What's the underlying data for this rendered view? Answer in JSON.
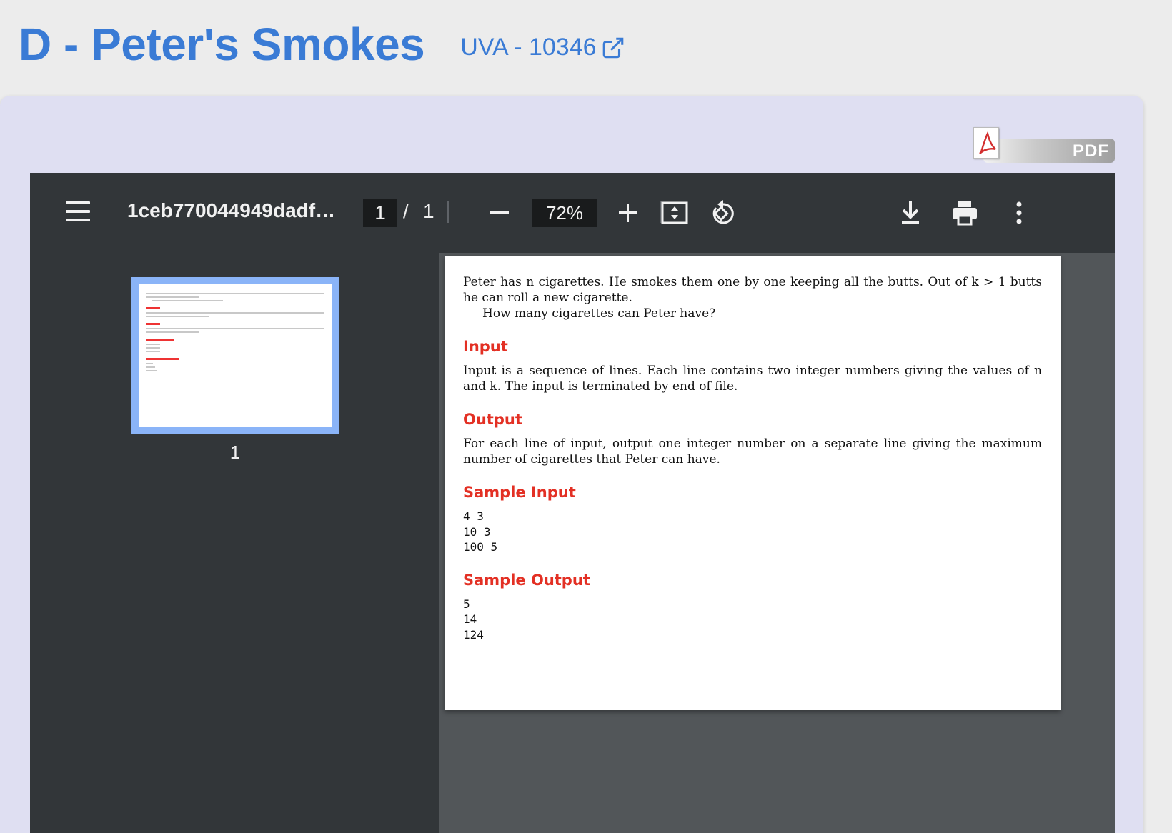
{
  "header": {
    "title": "D - Peter's Smokes",
    "origin_link": "UVA - 10346"
  },
  "pdf_badge": {
    "label": "PDF"
  },
  "toolbar": {
    "file_name": "1ceb770044949dadf…",
    "current_page": "1",
    "page_separator": "/",
    "total_pages": "1",
    "zoom": "72%"
  },
  "sidebar": {
    "thumb_page_number": "1"
  },
  "document": {
    "intro_line1": "Peter has n cigarettes. He smokes them one by one keeping all the butts. Out of k > 1 butts he can roll a new cigarette.",
    "intro_line2": "How many cigarettes can Peter have?",
    "input_heading": "Input",
    "input_text": "Input is a sequence of lines. Each line contains two integer numbers giving the values of n and k. The input is terminated by end of file.",
    "output_heading": "Output",
    "output_text": "For each line of input, output one integer number on a separate line giving the maximum number of cigarettes that Peter can have.",
    "sample_input_heading": "Sample Input",
    "sample_input": "4 3\n10 3\n100 5",
    "sample_output_heading": "Sample Output",
    "sample_output": "5\n14\n124"
  },
  "colors": {
    "title_blue": "#3a7bd5",
    "section_red": "#e33024",
    "toolbar_bg": "#323639"
  }
}
